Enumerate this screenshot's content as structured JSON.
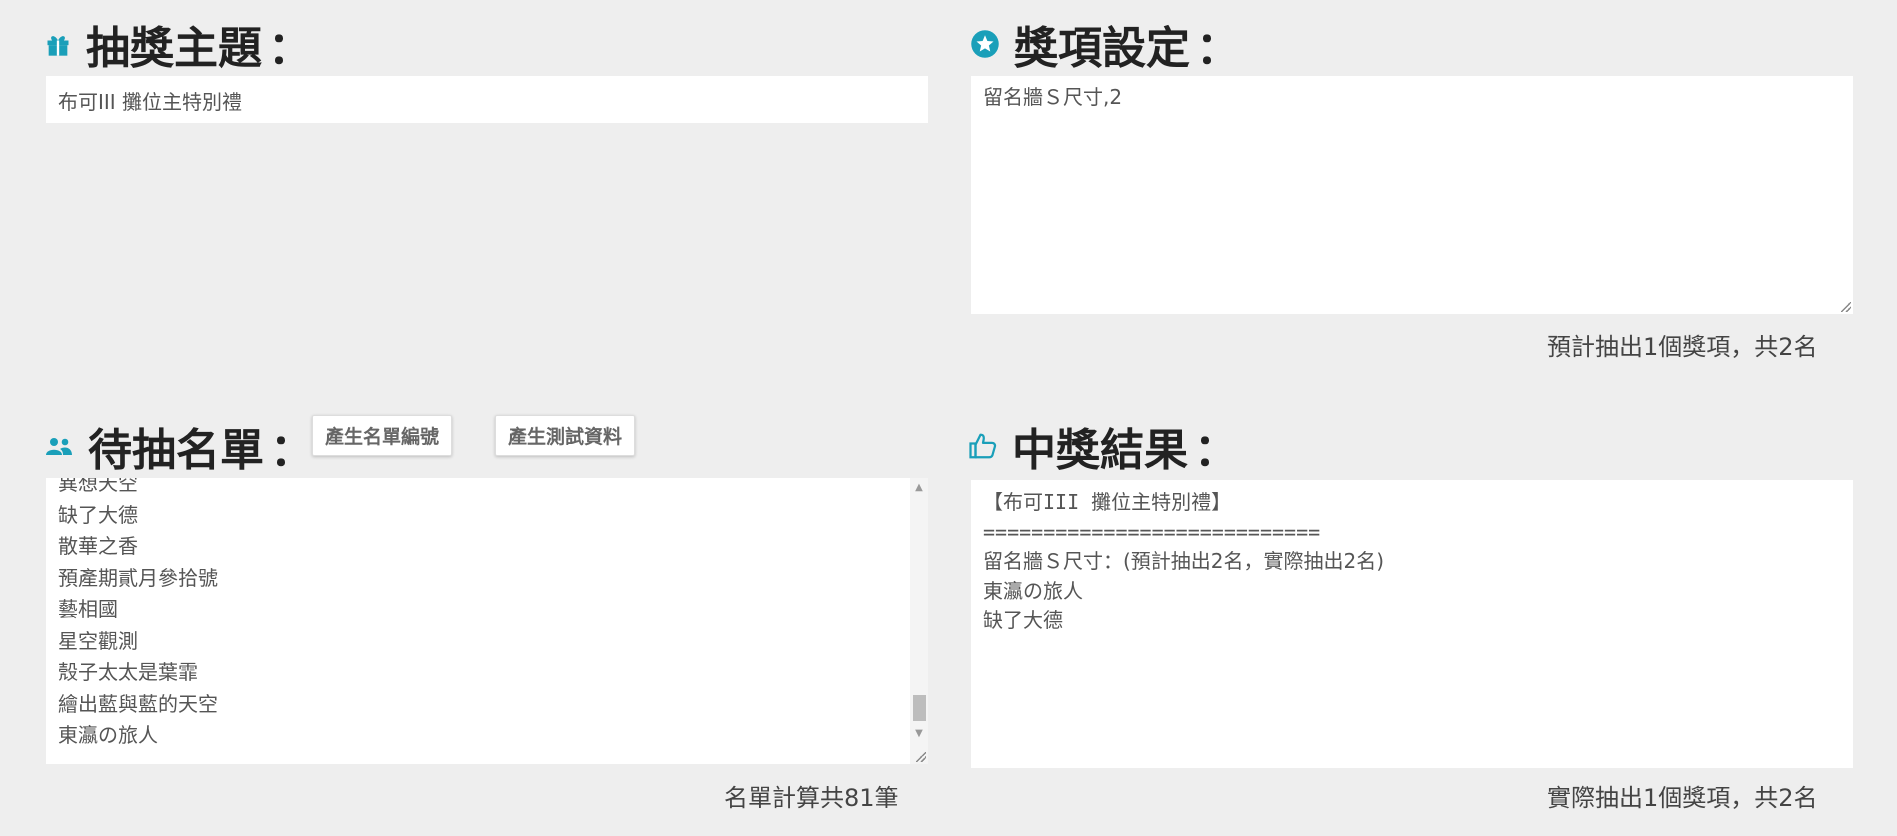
{
  "topic": {
    "title": "抽獎主題",
    "colon": "：",
    "icon": "gift-icon",
    "input_value": "布可III 攤位主特別禮"
  },
  "prizes": {
    "title": "獎項設定",
    "colon": "：",
    "icon": "star-icon",
    "textarea_value": "留名牆Ｓ尺寸,2",
    "summary": "預計抽出1個獎項，共2名"
  },
  "candidates": {
    "title": "待抽名單",
    "colon": "：",
    "icon": "users-icon",
    "buttons": {
      "generate_numbers": "產生名單編號",
      "generate_test": "產生測試資料"
    },
    "partial_top_item": "異想天空",
    "items": [
      "缺了大德",
      "散華之香",
      "預產期貳月參拾號",
      "藝相國",
      "星空觀測",
      "殼子太太是葉霏",
      "繪出藍與藍的天空",
      "東瀛の旅人"
    ],
    "summary": "名單計算共81筆",
    "scrollbar": {
      "up_arrow": "▲",
      "down_arrow": "▼"
    }
  },
  "results": {
    "title": "中獎結果",
    "colon": "：",
    "icon": "thumbs-up-icon",
    "lines": [
      "【布可III 攤位主特別禮】",
      "============================",
      "留名牆Ｓ尺寸：(預計抽出2名，實際抽出2名)",
      "東瀛の旅人",
      "缺了大德"
    ],
    "summary": "實際抽出1個獎項，共2名"
  },
  "colors": {
    "icon_accent": "#1a9fb9",
    "background": "#eeeeee"
  }
}
